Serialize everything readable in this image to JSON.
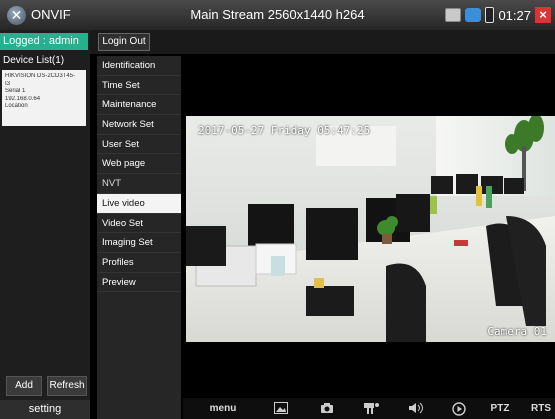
{
  "titlebar": {
    "app_name": "ONVIF",
    "app_icon": "onvif-logo-icon",
    "stream_info": "Main Stream 2560x1440 h264",
    "clock": "01:27",
    "status_icons": [
      "calculator-icon",
      "network-icon",
      "battery-icon",
      "close-icon"
    ]
  },
  "leftpanel": {
    "logged": "Logged : admin",
    "device_list_label": "Device List(1)",
    "device": {
      "model": "HIKVISION DS-2CD3T45-",
      "model_cont": "I3",
      "serial": "Serial 1",
      "ip": "192.168.0.64",
      "location": "Location"
    },
    "add_label": "Add",
    "refresh_label": "Refresh",
    "setting_label": "setting"
  },
  "topbar": {
    "login_out_label": "Login Out"
  },
  "menu": {
    "items": [
      {
        "label": "Identification"
      },
      {
        "label": "Time Set"
      },
      {
        "label": "Maintenance"
      },
      {
        "label": "Network Set"
      },
      {
        "label": "User Set"
      },
      {
        "label": "Web page"
      },
      {
        "label": "NVT"
      },
      {
        "label": "Live video"
      },
      {
        "label": "Video Set"
      },
      {
        "label": "Imaging Set"
      },
      {
        "label": "Profiles"
      },
      {
        "label": "Preview"
      }
    ],
    "active": "Live video"
  },
  "video": {
    "timestamp": "2017-05-27 Friday 05:47:25",
    "camera_label": "Camera 01"
  },
  "toolbar": {
    "menu_label": "menu",
    "ptz_label": "PTZ",
    "rtsp_label": "RTS",
    "icons": [
      "picture-icon",
      "camera-icon",
      "record-icon",
      "audio-icon",
      "play-icon"
    ]
  },
  "colors": {
    "accent_green": "#26b08d",
    "close_red": "#dd3333"
  }
}
